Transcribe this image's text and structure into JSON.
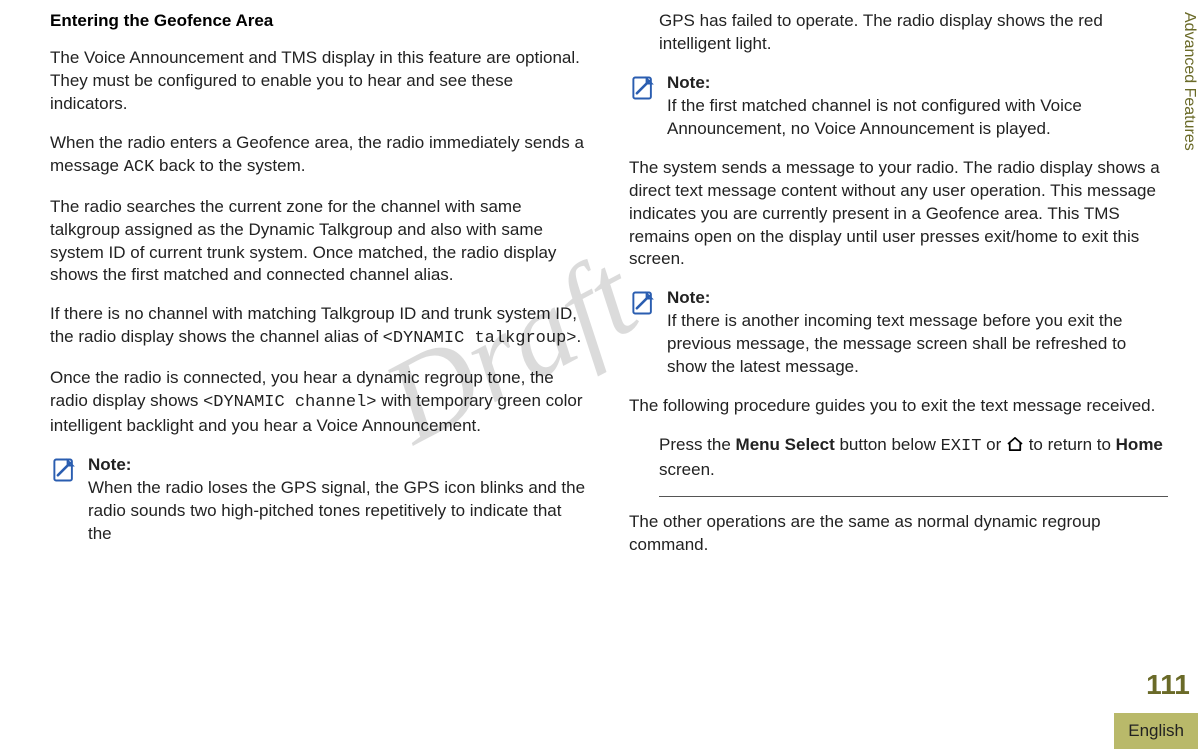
{
  "sideTab": "Advanced Features",
  "pageNumber": "111",
  "language": "English",
  "watermark": "Draft",
  "col1": {
    "heading": "Entering the Geofence Area",
    "p1": "The Voice Announcement and TMS display in this feature are optional. They must be configured to enable you to hear and see these indicators.",
    "p2a": "When the radio enters a Geofence area, the radio immediately sends a message ",
    "p2code": "ACK",
    "p2b": " back to the system.",
    "p3": "The radio searches the current zone for the channel with same talkgroup assigned as the Dynamic Talkgroup and also with same system ID of current trunk system. Once matched, the radio display shows the first matched and connected channel alias.",
    "p4a": "If there is no channel with matching Talkgroup ID and trunk system ID, the radio display shows the channel alias of ",
    "p4code": "<DYNAMIC talkgroup>",
    "p4b": ".",
    "p5a": "Once the radio is connected, you hear a dynamic regroup tone, the radio display shows ",
    "p5code": "<DYNAMIC channel>",
    "p5b": " with temporary green color intelligent backlight and you hear a Voice Announcement.",
    "note1": {
      "label": "Note:",
      "text": "When the radio loses the GPS signal, the GPS icon blinks and the radio sounds two high-pitched tones repetitively to indicate that the"
    }
  },
  "col2": {
    "p1": "GPS has failed to operate. The radio display shows the red intelligent light.",
    "note2": {
      "label": "Note:",
      "text": "If the first matched channel is not configured with Voice Announcement, no Voice Announcement is played."
    },
    "p2": "The system sends a message to your radio. The radio display shows a direct text message content without any user operation. This message indicates you are currently present in a Geofence area. This TMS remains open on the display until user presses exit/home to exit this screen.",
    "note3": {
      "label": "Note:",
      "text": "If there is another incoming text message before you exit the previous message, the message screen shall be refreshed to show the latest message."
    },
    "p3": "The following procedure guides you to exit the text message received.",
    "step": {
      "a": "Press the ",
      "b": "Menu Select",
      "c": " button below ",
      "code": "EXIT",
      "d": " or ",
      "e": " to return to ",
      "f": "Home",
      "g": " screen."
    },
    "p4": "The other operations are the same as normal dynamic regroup command."
  }
}
